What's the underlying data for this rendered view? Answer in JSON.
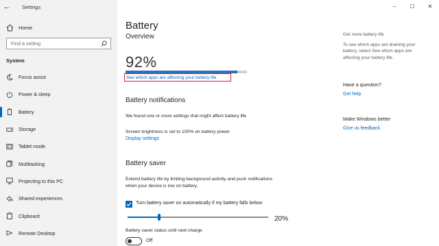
{
  "titlebar": {
    "app_title": "Settings",
    "back_label": "←",
    "controls": {
      "minimize": "–",
      "maximize": "☐",
      "close": "✕"
    }
  },
  "sidebar": {
    "home_label": "Home",
    "search": {
      "placeholder": "Find a setting",
      "value": ""
    },
    "section_label": "System",
    "items": [
      {
        "label": "Focus assist",
        "icon": "moon-icon",
        "active": false
      },
      {
        "label": "Power & sleep",
        "icon": "power-icon",
        "active": false
      },
      {
        "label": "Battery",
        "icon": "battery-icon",
        "active": true
      },
      {
        "label": "Storage",
        "icon": "storage-icon",
        "active": false
      },
      {
        "label": "Tablet mode",
        "icon": "tablet-icon",
        "active": false
      },
      {
        "label": "Multitasking",
        "icon": "multitasking-icon",
        "active": false
      },
      {
        "label": "Projecting to this PC",
        "icon": "projector-icon",
        "active": false
      },
      {
        "label": "Shared experiences",
        "icon": "shared-icon",
        "active": false
      },
      {
        "label": "Clipboard",
        "icon": "clipboard-icon",
        "active": false
      },
      {
        "label": "Remote Desktop",
        "icon": "remote-desktop-icon",
        "active": false
      }
    ]
  },
  "main": {
    "page_title": "Battery",
    "overview": {
      "heading": "Overview",
      "percent_text": "92%",
      "charge_fraction": 0.92,
      "link": "See which apps are affecting your battery life"
    },
    "notifications": {
      "heading": "Battery notifications",
      "found_text": "We found one or more settings that might affect battery life",
      "brightness_text": "Screen brightness is set to 100% on battery power",
      "display_link": "Display settings"
    },
    "saver": {
      "heading": "Battery saver",
      "description_line1": "Extend battery life by limiting background activity and push notifications",
      "description_line2": "when your device is low on battery.",
      "checkbox_label": "Turn battery saver on automatically if my battery falls below:",
      "checkbox_checked": true,
      "slider_value_text": "20%",
      "slider_fraction": 0.2,
      "status_label": "Battery saver status until next charge",
      "toggle_state": "Off"
    }
  },
  "right": {
    "more_heading": "Get more battery life",
    "more_text_line1": "To see which apps are draining your",
    "more_text_line2": "battery, select See which apps are",
    "more_text_line3": "affecting your battery life.",
    "question_heading": "Have a question?",
    "help_link": "Get help",
    "improve_heading": "Make Windows better",
    "feedback_link": "Give us feedback"
  },
  "colors": {
    "accent": "#0067c0",
    "highlight_box": "#e5181e",
    "sidebar_bg": "#f2f2f2"
  }
}
